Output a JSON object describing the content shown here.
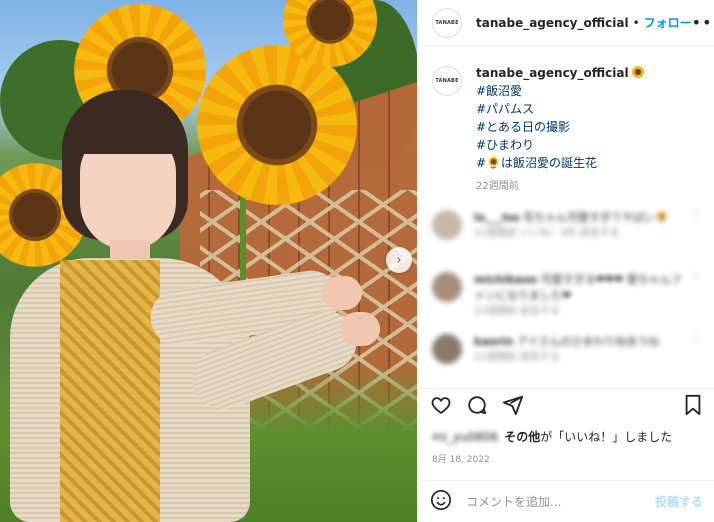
{
  "post": {
    "account": "tanabe_agency_official",
    "avatar_text": "TANABE",
    "follow_label": "フォロー",
    "separator": "•",
    "more_label": "•••",
    "caption_lines": [
      "#飯沼愛",
      "#パパムス",
      "#とある日の撮影",
      "#ひまわり",
      "#🌻は飯沼愛の誕生花"
    ],
    "caption_time": "22週間前",
    "carousel_next": "›"
  },
  "comments": [
    {
      "user": "lo___lse",
      "text": "花ちゃん可愛すぎてやばい🌻",
      "meta": "22週間前  いいね！4件  返信する"
    },
    {
      "user": "michikaoo",
      "text": "可愛すぎる❤❤❤ 愛ちゃんファンになりました❤",
      "meta": "22週間前  返信する"
    },
    {
      "user": "kaorin",
      "text": "アイさんのひまわり似合うね",
      "meta": "22週間前  返信する"
    }
  ],
  "actions": {
    "liked_by_prefix": "mi_yu0806",
    "liked_by_suffix_bold": "その他",
    "liked_by_rest": "が「いいね！」しました",
    "date": "8月 18, 2022"
  },
  "comment_box": {
    "placeholder": "コメントを追加...",
    "post_label": "投稿する"
  },
  "colors": {
    "follow": "#0095f6",
    "hashtag": "#00376b",
    "muted": "#8e8e8e",
    "post_disabled": "#b2dffc"
  }
}
